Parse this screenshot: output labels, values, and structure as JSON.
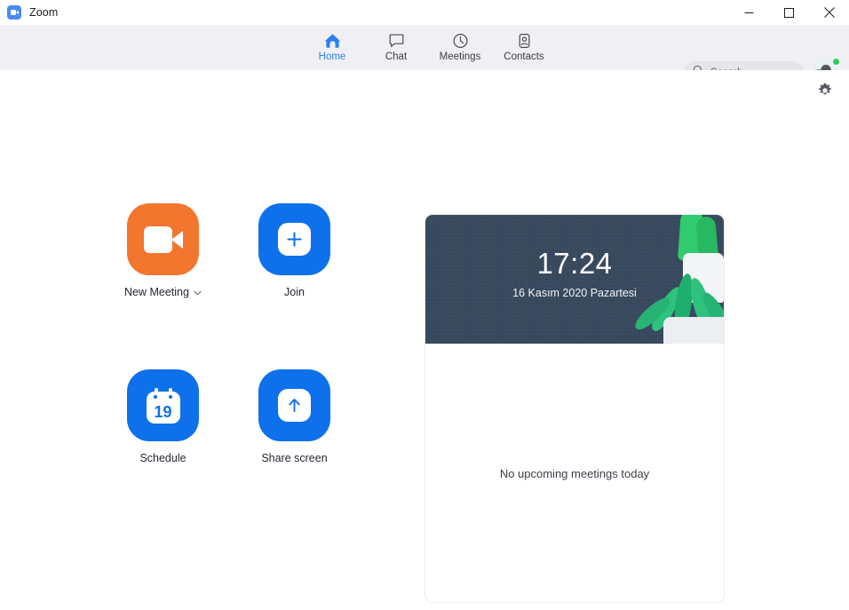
{
  "window": {
    "app_title": "Zoom",
    "logo_icon": "zoom-camera-icon",
    "controls": {
      "minimize_label": "Minimize",
      "maximize_label": "Maximize",
      "close_label": "Close"
    }
  },
  "header": {
    "tabs": [
      {
        "label": "Home",
        "icon": "home-icon",
        "active": true
      },
      {
        "label": "Chat",
        "icon": "chat-bubble-icon",
        "active": false
      },
      {
        "label": "Meetings",
        "icon": "clock-icon",
        "active": false
      },
      {
        "label": "Contacts",
        "icon": "contact-person-icon",
        "active": false
      }
    ],
    "search": {
      "placeholder": "Search",
      "value": "",
      "icon": "search-icon"
    },
    "avatar": {
      "icon": "user-avatar",
      "status": "available",
      "status_color": "#2ecc5d"
    }
  },
  "body": {
    "settings_button": {
      "icon": "gear-icon",
      "label": "Settings"
    },
    "actions": [
      {
        "label": "New Meeting",
        "icon": "video-camera-icon",
        "color": "#f2762e",
        "has_dropdown": true,
        "dropdown_icon": "chevron-down-icon"
      },
      {
        "label": "Join",
        "icon": "plus-icon",
        "color": "#0e71eb",
        "has_dropdown": false
      },
      {
        "label": "Schedule",
        "icon": "calendar-icon",
        "color": "#0e71eb",
        "has_dropdown": false,
        "calendar_day": "19"
      },
      {
        "label": "Share screen",
        "icon": "arrow-up-icon",
        "color": "#0e71eb",
        "has_dropdown": false
      }
    ],
    "meeting_card": {
      "time": "17:24",
      "date": "16 Kasım 2020 Pazartesi",
      "banner_color": "#38495e",
      "empty_text": "No upcoming meetings today",
      "illustration": "potted-plants-icon"
    }
  }
}
